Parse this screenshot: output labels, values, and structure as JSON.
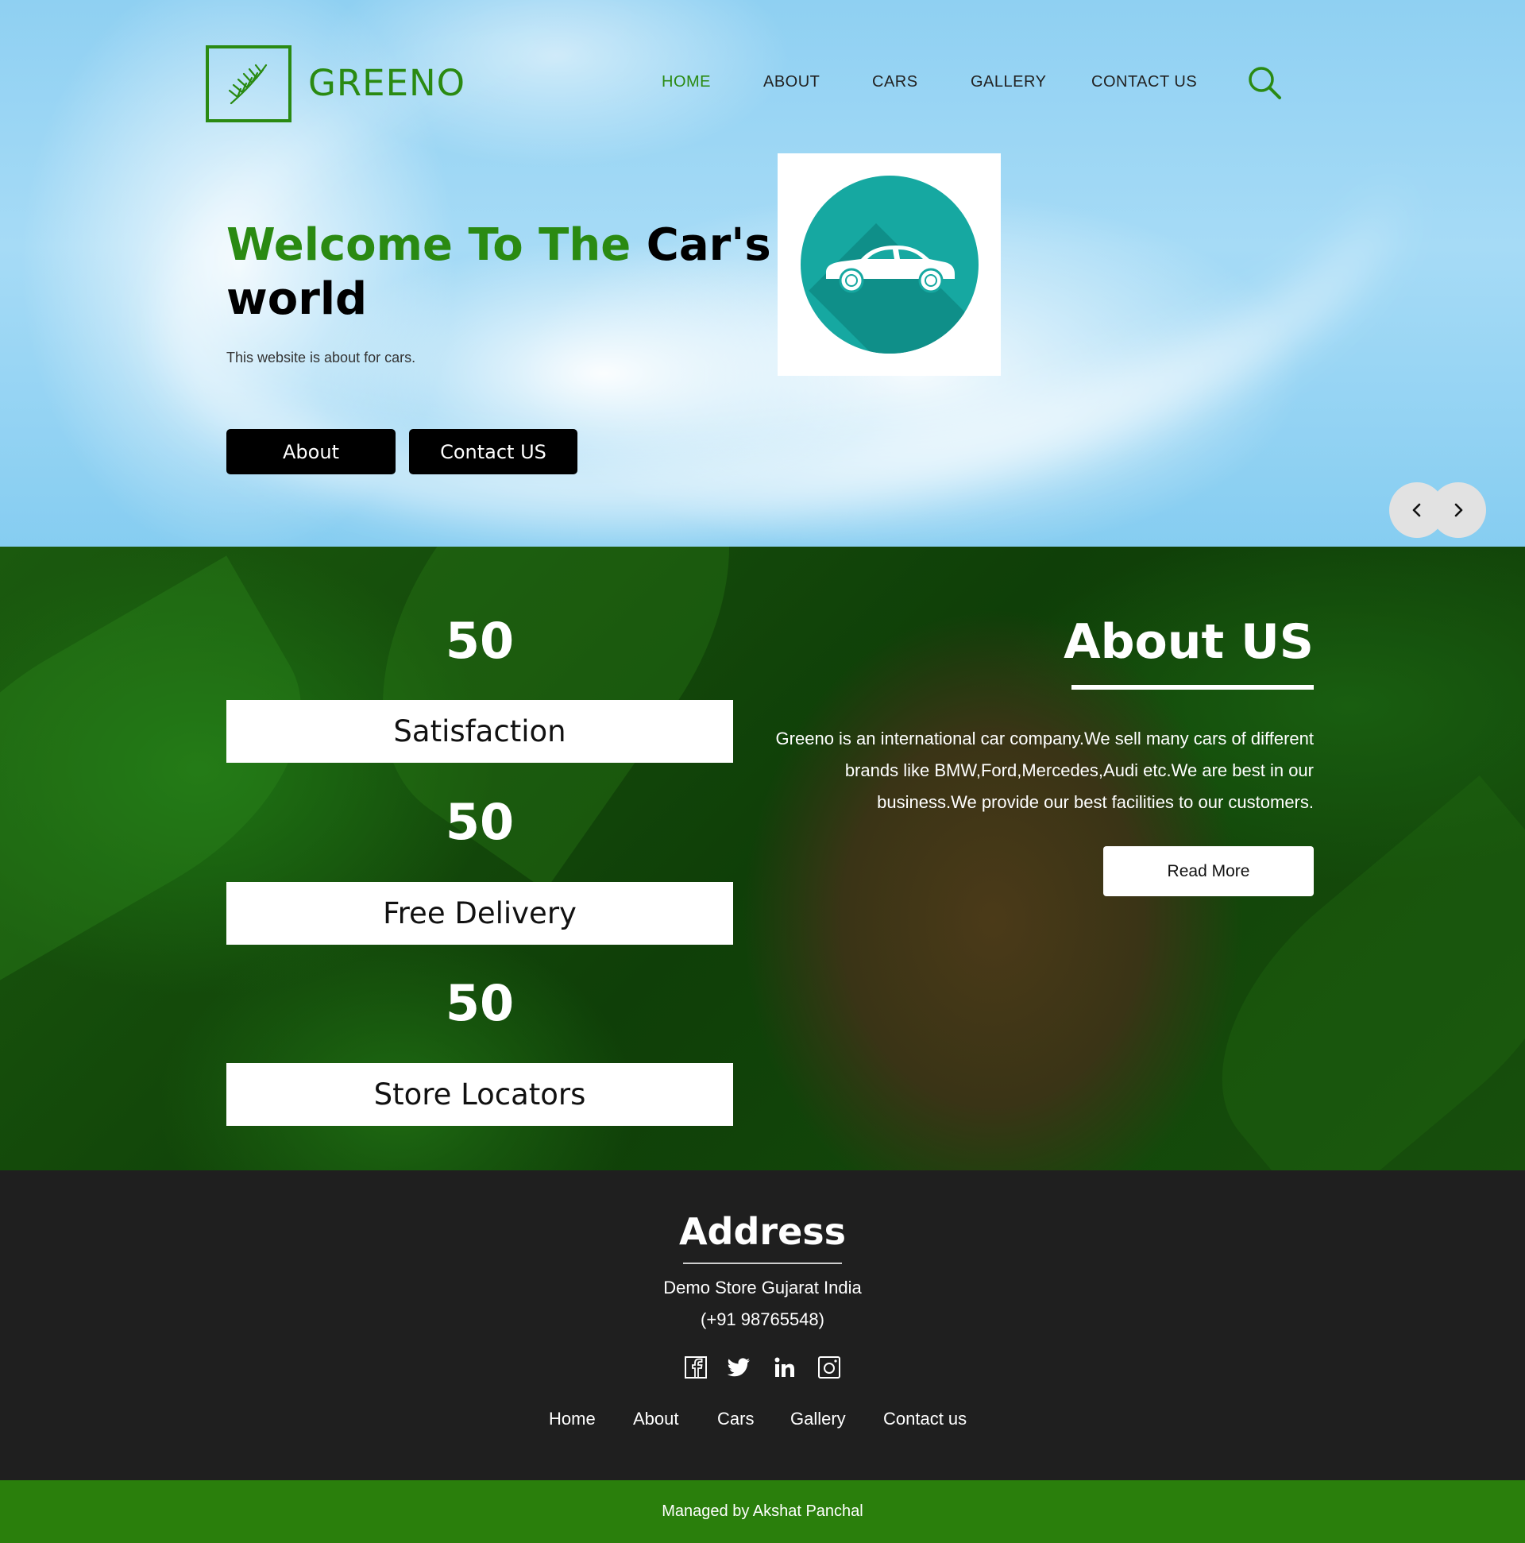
{
  "header": {
    "brand": "GREENO",
    "nav": [
      "HOME",
      "ABOUT",
      "CARS",
      "GALLERY",
      "CONTACT US"
    ],
    "active_nav": "HOME"
  },
  "hero": {
    "title_green": "Welcome To The",
    "title_black_1": "Car's",
    "title_black_2": "world",
    "subtitle": "This website is about for cars.",
    "about_button": "About",
    "contact_button": "Contact US"
  },
  "stats": [
    {
      "number": "50",
      "label": "Satisfaction"
    },
    {
      "number": "50",
      "label": "Free Delivery"
    },
    {
      "number": "50",
      "label": "Store Locators"
    }
  ],
  "about": {
    "title": "About US",
    "text": "Greeno is an international car company.We sell many cars of different brands like BMW,Ford,Mercedes,Audi etc.We are best in our business.We provide our best facilities to our customers.",
    "button": "Read More"
  },
  "footer": {
    "title": "Address",
    "address": "Demo Store Gujarat India",
    "phone": "(+91 98765548)",
    "socials": [
      "facebook-icon",
      "twitter-icon",
      "linkedin-icon",
      "instagram-icon"
    ],
    "links": [
      "Home",
      "About",
      "Cars",
      "Gallery",
      "Contact us"
    ],
    "credit": "Managed by Akshat Panchal"
  },
  "colors": {
    "brand_green": "#2a8a12",
    "footer_dark": "#1f1f1f",
    "bottom_bar_green": "#2a7f0c",
    "car_icon_teal": "#16a8a1"
  }
}
